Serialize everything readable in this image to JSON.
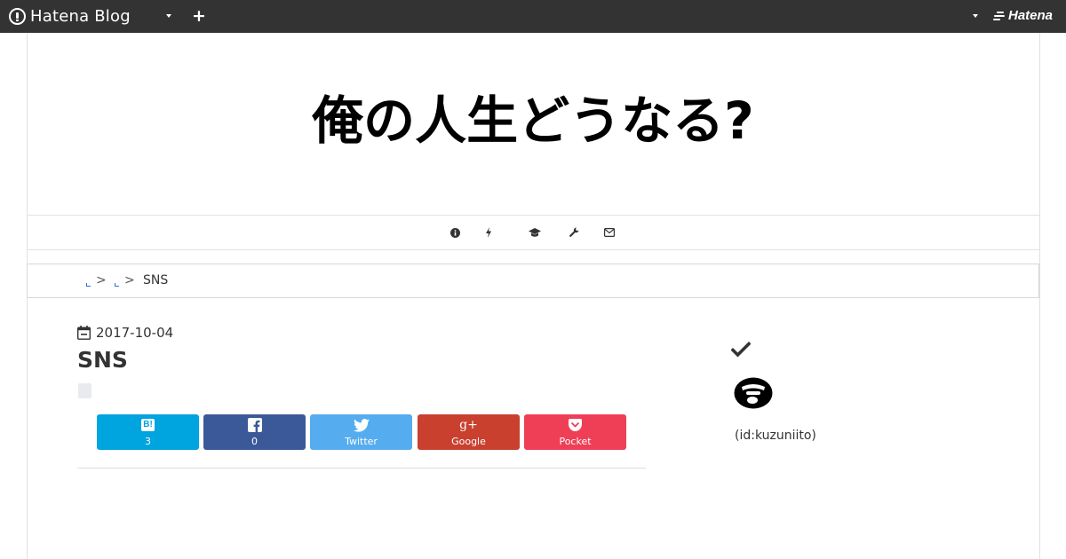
{
  "topbar": {
    "logo_text": "Hatena Blog",
    "hatena_text": "Hatena",
    "plus_label": "+"
  },
  "blog": {
    "title": "俺の人生どうなる?"
  },
  "nav": {
    "icons": [
      "info-icon",
      "bolt-icon",
      "graduation-cap-icon",
      "wrench-icon",
      "envelope-icon"
    ]
  },
  "breadcrumb": {
    "separator": ">",
    "current": "SNS"
  },
  "entry": {
    "date": "2017-10-04",
    "title": "SNS"
  },
  "share": {
    "hatena": {
      "icon_text": "B!",
      "label": "3",
      "color": "#00a4de"
    },
    "facebook": {
      "label": "0",
      "color": "#3b5998"
    },
    "twitter": {
      "label": "Twitter",
      "color": "#55acee"
    },
    "google": {
      "icon_text": "g+",
      "label": "Google",
      "color": "#c9402f"
    },
    "pocket": {
      "label": "Pocket",
      "color": "#ef3f56"
    }
  },
  "sidebar": {
    "user_id": "(id:kuzuniito)"
  },
  "colors": {
    "topbar_bg": "#333333",
    "link_blue": "#2b6fd6"
  }
}
